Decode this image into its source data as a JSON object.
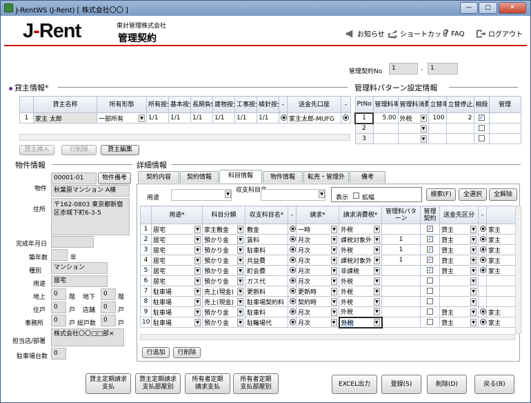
{
  "window": {
    "title": "J-RentWS (J-Rent) [ 株式会社〇〇 ]",
    "minimize": "—",
    "maximize": "□",
    "close": "✕"
  },
  "header": {
    "logo_j": "J",
    "logo_dash": "-",
    "logo_rent": "Rent",
    "company": "東計管理株式会社",
    "page_title": "管理契約",
    "links": [
      {
        "name": "notice",
        "label": "お知らせ"
      },
      {
        "name": "shortcut",
        "label": "ショートカット"
      },
      {
        "name": "faq",
        "label": "FAQ"
      },
      {
        "name": "logout",
        "label": "ログアウト"
      }
    ]
  },
  "contract_no": {
    "label": "管理契約No",
    "value1": "1",
    "sep": "-",
    "value2": "1"
  },
  "owner": {
    "section": "貸主情報*",
    "headers": [
      "貸主名称",
      "所有形態",
      "所有按分",
      "基本按分",
      "長期負債",
      "建物按分",
      "工事按分",
      "検針按分",
      "-",
      "送金先口座",
      "-"
    ],
    "row": {
      "no": "1",
      "name": "家主 太郎",
      "form": "一部所有",
      "r1": "1/1",
      "r2": "1/1",
      "r3": "1/1",
      "r4": "1/1",
      "r5": "1/1",
      "r6": "1/1",
      "account": "家主太郎-MUFG"
    },
    "buttons": {
      "insert": "貸主挿入",
      "delete": "行削除",
      "edit": "貸主編集"
    }
  },
  "fee_pattern": {
    "section": "管理料パターン設定情報",
    "headers": [
      "PtNo",
      "管理料率*",
      "管理料消費税",
      "立替率*",
      "立替停止月数",
      "相殺",
      "管理"
    ],
    "rows": [
      {
        "no": "1",
        "rate": "5.00",
        "tax": "外税",
        "advance": "100",
        "stop": "2",
        "offset": true
      },
      {
        "no": "2",
        "rate": "",
        "tax": "",
        "advance": "",
        "stop": "",
        "offset": false
      },
      {
        "no": "3",
        "rate": "",
        "tax": "",
        "advance": "",
        "stop": "",
        "offset": false
      }
    ]
  },
  "property": {
    "section": "物件情報",
    "code": "00001-01",
    "remark_button": "物件備考",
    "name_label": "物件",
    "name": "秋葉原マンション A棟",
    "address_label": "住所",
    "address": "〒162-0803 東京都新宿区赤城下町6-3-5",
    "built_label": "完成年月日",
    "built": "",
    "age_label": "築年数",
    "age": "",
    "age_unit": "年",
    "structure_label": "種別",
    "structure": "マンション",
    "use_label": "用途",
    "use": "居宅",
    "above_label": "地上",
    "above": "0",
    "above_unit": "階",
    "below_label": "地下",
    "below": "0",
    "below_unit": "階",
    "houses_label": "住戸",
    "houses": "0",
    "houses_unit": "戸",
    "shops_label": "店舗",
    "shops": "0",
    "shops_unit": "戸",
    "offices_label": "事務所",
    "offices": "0",
    "offices_unit": "戸",
    "total_label": "総戸数",
    "total": "0",
    "total_unit": "戸",
    "store_label": "担当店/部署",
    "store": "株式会社〇〇□□部×",
    "parking_label": "駐車場台数",
    "parking": "0"
  },
  "detail": {
    "section": "詳細情報",
    "tabs": [
      "契約内容",
      "契約情報",
      "科目情報",
      "物件情報",
      "転売・管理外",
      "備考"
    ],
    "active_tab": 2,
    "filter": {
      "use_label": "用途",
      "subject_label": "収支科目名",
      "display_label": "表示",
      "expand_label": "拡幅",
      "search": "検索(F)",
      "select_all": "全選択",
      "clear_all": "全解除"
    },
    "headers": [
      "用途*",
      "科目分類",
      "収支科目名*",
      "-",
      "請求*",
      "請求消費税*",
      "管理料パターン",
      "管理契約",
      "送金先区分",
      "-"
    ],
    "rows": [
      {
        "no": "1",
        "use": "居宅",
        "cat": "家主敷金",
        "subject": "敷金",
        "bill": "一時",
        "tax": "外税",
        "pattern": "",
        "contract": true,
        "dest": "貸主",
        "extra": "家主"
      },
      {
        "no": "2",
        "use": "居宅",
        "cat": "預かり金",
        "subject": "賃料",
        "bill": "月次",
        "tax": "課税対象外",
        "pattern": "1",
        "contract": true,
        "dest": "貸主",
        "extra": "家主"
      },
      {
        "no": "3",
        "use": "居宅",
        "cat": "預かり金",
        "subject": "駐車料",
        "bill": "月次",
        "tax": "外税",
        "pattern": "1",
        "contract": true,
        "dest": "貸主",
        "extra": "家主"
      },
      {
        "no": "4",
        "use": "居宅",
        "cat": "預かり金",
        "subject": "共益費",
        "bill": "月次",
        "tax": "課税対象外",
        "pattern": "1",
        "contract": true,
        "dest": "貸主",
        "extra": "家主"
      },
      {
        "no": "5",
        "use": "居宅",
        "cat": "預かり金",
        "subject": "町会費",
        "bill": "月次",
        "tax": "非課税",
        "pattern": "",
        "contract": true,
        "dest": "貸主",
        "extra": "家主"
      },
      {
        "no": "6",
        "use": "居宅",
        "cat": "預かり金",
        "subject": "ガス代",
        "bill": "月次",
        "tax": "外税",
        "pattern": "",
        "contract": false,
        "dest": "",
        "extra": ""
      },
      {
        "no": "7",
        "use": "駐車場",
        "cat": "売上(現金)",
        "subject": "更新料",
        "bill": "更新時",
        "tax": "外税",
        "pattern": "",
        "contract": false,
        "dest": "",
        "extra": ""
      },
      {
        "no": "8",
        "use": "駐車場",
        "cat": "売上(現金)",
        "subject": "駐車場契約料",
        "bill": "契約時",
        "tax": "外税",
        "pattern": "",
        "contract": false,
        "dest": "",
        "extra": ""
      },
      {
        "no": "9",
        "use": "駐車場",
        "cat": "預かり金",
        "subject": "駐車料",
        "bill": "月次",
        "tax": "外税",
        "pattern": "",
        "contract": false,
        "dest": "貸主",
        "extra": "家主"
      },
      {
        "no": "10",
        "use": "駐車場",
        "cat": "預かり金",
        "subject": "駐輪場代",
        "bill": "月次",
        "tax": "外税",
        "pattern": "",
        "contract": false,
        "dest": "貸主",
        "extra": "家主"
      }
    ],
    "buttons": {
      "add": "行追加",
      "delete": "行削除"
    }
  },
  "footer": {
    "b1": "貸主定期請求\n支払",
    "b2": "貸主定期請求\n支払部屋別",
    "b3": "所有者定期\n請求支払",
    "b4": "所有者定期\n支払部屋別",
    "excel": "EXCEL出力",
    "save": "登録(S)",
    "del": "削除(D)",
    "back": "戻る(B)"
  },
  "colors": {
    "accent": "#cc0000",
    "title_bar": "#7d9cc4"
  }
}
